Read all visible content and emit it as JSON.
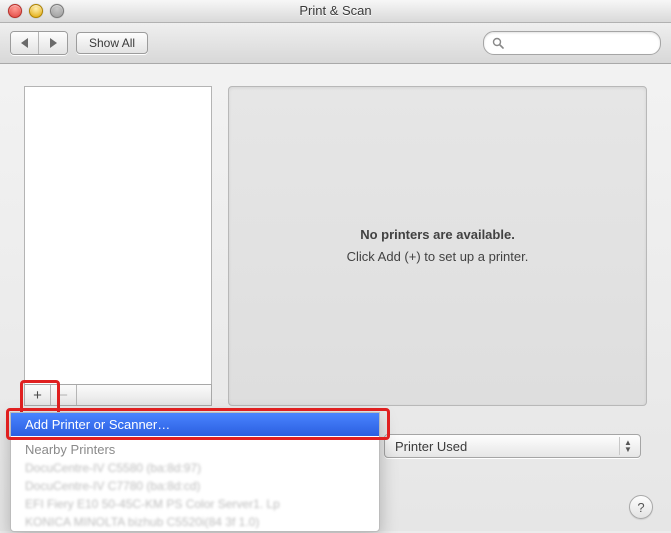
{
  "window": {
    "title": "Print & Scan"
  },
  "toolbar": {
    "show_all": "Show All",
    "search_placeholder": ""
  },
  "detail": {
    "line1": "No printers are available.",
    "line2": "Click Add (+) to set up a printer."
  },
  "list_footer": {
    "add_glyph": "+",
    "remove_glyph": "−"
  },
  "popup": {
    "add_item": "Add Printer or Scanner…",
    "nearby_header": "Nearby Printers",
    "nearby": [
      "DocuCentre-IV C5580 (ba:8d:97)",
      "DocuCentre-IV C7780 (ba:8d:cd)",
      "EFI Fiery E10 50-45C-KM PS Color Server1. Lp",
      "KONICA MINOLTA bizhub C5520i(84 3f 1.0)"
    ]
  },
  "default_printer": {
    "visible_label_fragment": "Printer Used"
  },
  "help": {
    "glyph": "?"
  }
}
